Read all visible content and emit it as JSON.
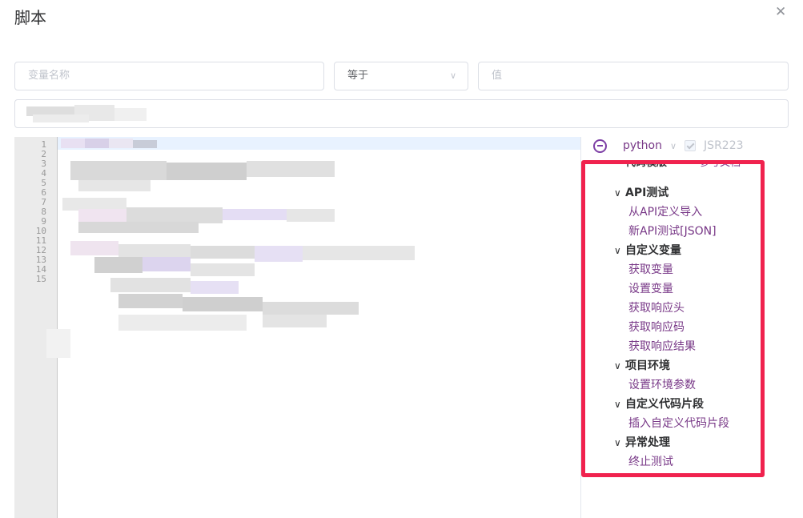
{
  "dialog": {
    "title": "脚本"
  },
  "condition": {
    "name_placeholder": "变量名称",
    "operator": "等于",
    "value_placeholder": "值"
  },
  "editor": {
    "line_numbers": [
      "1",
      "2",
      "3",
      "4",
      "5",
      "6",
      "7",
      "8",
      "9",
      "10",
      "11",
      "12",
      "13",
      "14",
      "15"
    ]
  },
  "toolbar": {
    "language": "python",
    "jsr_label": "JSR223"
  },
  "template": {
    "heading": "代码模版",
    "doc_link": "参考文档",
    "groups": [
      {
        "label": "API测试",
        "items": [
          "从API定义导入",
          "新API测试[JSON]"
        ]
      },
      {
        "label": "自定义变量",
        "items": [
          "获取变量",
          "设置变量",
          "获取响应头",
          "获取响应码",
          "获取响应结果"
        ]
      },
      {
        "label": "项目环境",
        "items": [
          "设置环境参数"
        ]
      },
      {
        "label": "自定义代码片段",
        "items": [
          "插入自定义代码片段"
        ]
      },
      {
        "label": "异常处理",
        "items": [
          "终止测试"
        ]
      }
    ]
  },
  "colors": {
    "accent": "#783887",
    "highlight": "#f0224e"
  }
}
